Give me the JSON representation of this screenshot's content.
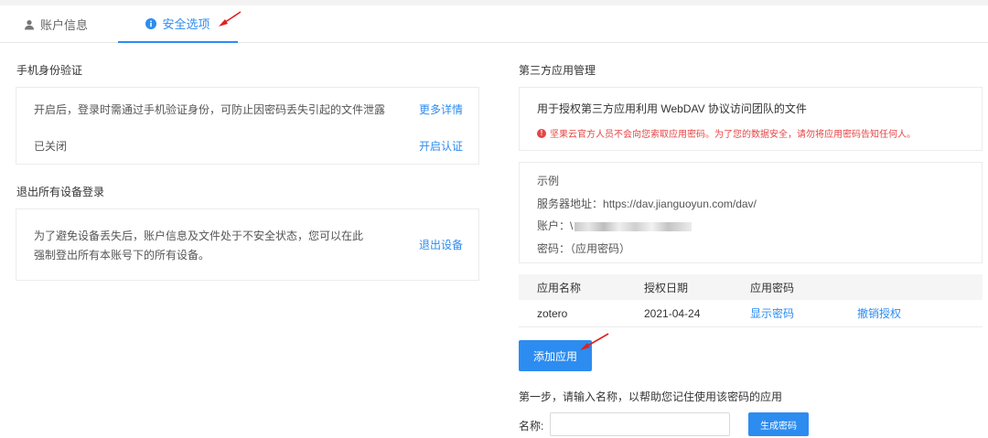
{
  "tabs": [
    {
      "label": "账户信息",
      "icon": "user-icon",
      "active": false
    },
    {
      "label": "安全选项",
      "icon": "info-icon",
      "active": true
    }
  ],
  "colors": {
    "accent": "#2d8cf0",
    "danger": "#e64545",
    "annotation": "#e02020"
  },
  "phone_auth": {
    "title": "手机身份验证",
    "description": "开启后，登录时需通过手机验证身份，可防止因密码丢失引起的文件泄露",
    "more_link": "更多详情",
    "status": "已关闭",
    "enable_link": "开启认证"
  },
  "logout_all": {
    "title": "退出所有设备登录",
    "line1": "为了避免设备丢失后，账户信息及文件处于不安全状态，您可以在此",
    "line2": "强制登出所有本账号下的所有设备。",
    "action_link": "退出设备"
  },
  "third_party": {
    "title": "第三方应用管理",
    "description": "用于授权第三方应用利用 WebDAV 协议访问团队的文件",
    "warning": "坚果云官方人员不会向您索取应用密码。为了您的数据安全，请勿将应用密码告知任何人。",
    "example": {
      "title": "示例",
      "server_label": "服务器地址：",
      "server_value": "https://dav.jianguoyun.com/dav/",
      "account_label": "账户：",
      "account_prefix": "\\",
      "password_label": "密码：",
      "password_value": "（应用密码）"
    },
    "table": {
      "headers": [
        "应用名称",
        "授权日期",
        "应用密码"
      ],
      "rows": [
        {
          "name": "zotero",
          "date": "2021-04-24",
          "show_password": "显示密码",
          "revoke": "撤销授权"
        }
      ]
    },
    "add_button": "添加应用",
    "step_text": "第一步，请输入名称，以帮助您记住使用该密码的应用",
    "name_label": "名称:",
    "name_value": "",
    "name_placeholder": "",
    "generate_button": "生成密码"
  }
}
